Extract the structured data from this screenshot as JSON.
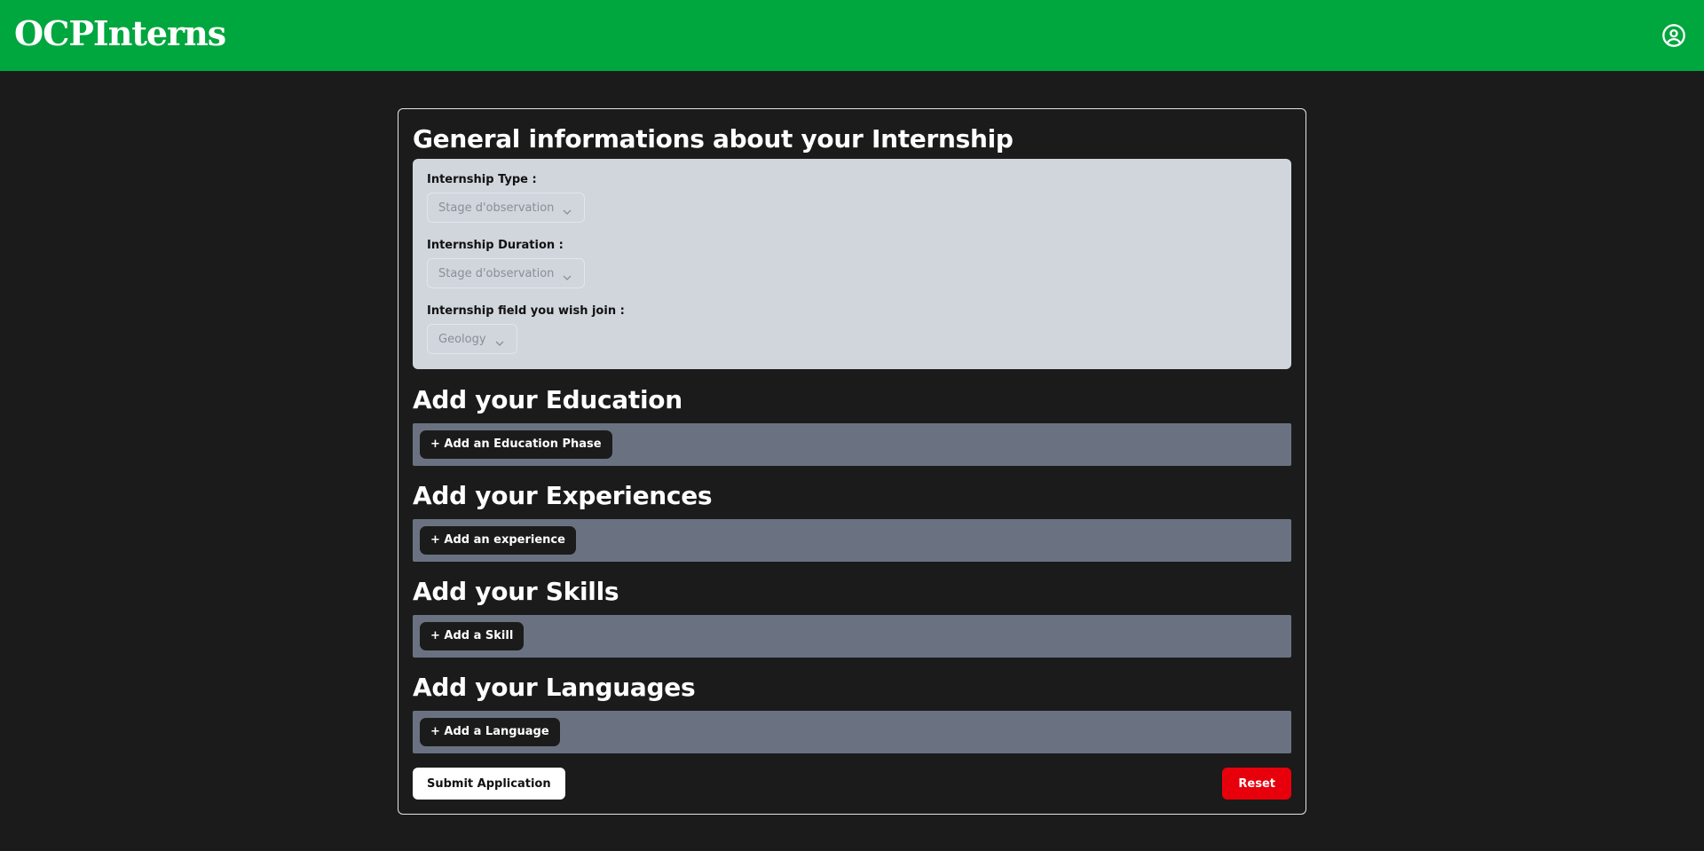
{
  "app": {
    "brand": "OCPInterns",
    "account_icon": "user-circle-icon",
    "colors": {
      "navbar": "#00a63e",
      "background": "#1b1b1b",
      "general_panel": "#d1d5dc",
      "add_panel": "#6a7282",
      "reset": "#e7000b"
    }
  },
  "general": {
    "title": "General informations about your Internship",
    "internship_type": {
      "label": "Internship Type :",
      "value": "Stage d'observation"
    },
    "internship_duration": {
      "label": "Internship Duration :",
      "value": "Stage d'observation"
    },
    "internship_field": {
      "label": "Internship field you wish join :",
      "value": "Geology"
    }
  },
  "education": {
    "title": "Add your Education",
    "button": "+ Add an Education Phase"
  },
  "experiences": {
    "title": "Add your Experiences",
    "button": "+ Add an experience"
  },
  "skills": {
    "title": "Add your Skills",
    "button": "+ Add a Skill"
  },
  "languages": {
    "title": "Add your Languages",
    "button": "+ Add a Language"
  },
  "actions": {
    "submit": "Submit Application",
    "reset": "Reset"
  }
}
